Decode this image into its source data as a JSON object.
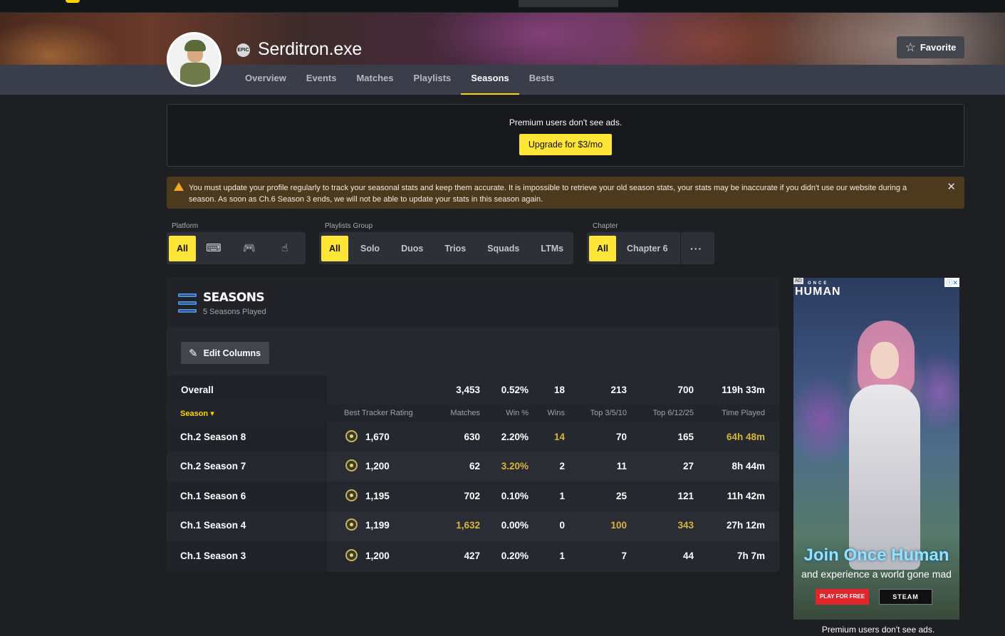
{
  "profile": {
    "username": "Serditron.exe",
    "platform_badge": "EPIC",
    "favorite_label": "Favorite"
  },
  "tabs": [
    "Overview",
    "Events",
    "Matches",
    "Playlists",
    "Seasons",
    "Bests"
  ],
  "active_tab": "Seasons",
  "premium": {
    "text": "Premium users don't see ads.",
    "upgrade_label": "Upgrade for $3/mo"
  },
  "warning": {
    "text": "You must update your profile regularly to track your seasonal stats and keep them accurate. It is impossible to retrieve your old season stats, your stats may be inaccurate if you didn't use our website during a season. As soon as Ch.6 Season 3 ends, we will not be able to update your stats in this season again."
  },
  "filters": {
    "platform": {
      "label": "Platform",
      "all": "All",
      "icons": [
        "keyboard-icon",
        "gamepad-icon",
        "touch-icon"
      ]
    },
    "playlists": {
      "label": "Playlists Group",
      "options": [
        "All",
        "Solo",
        "Duos",
        "Trios",
        "Squads",
        "LTMs"
      ]
    },
    "chapter": {
      "label": "Chapter",
      "options": [
        "All",
        "Chapter 6"
      ],
      "more": "···"
    }
  },
  "seasons_panel": {
    "title": "SEASONS",
    "subtitle": "5 Seasons Played",
    "edit_label": "Edit Columns",
    "overall_label": "Overall",
    "overall": [
      "3,453",
      "0.52%",
      "18",
      "213",
      "700",
      "119h 33m"
    ],
    "sort_label": "Season",
    "headers": [
      "Best Tracker Rating",
      "Matches",
      "Win %",
      "Wins",
      "Top 3/5/10",
      "Top 6/12/25",
      "Time Played"
    ],
    "rows": [
      {
        "season": "Ch.2 Season 8",
        "rating": "1,670",
        "matches": "630",
        "win_pct": "2.20%",
        "wins": "14",
        "top10": "70",
        "top25": "165",
        "time": "64h 48m"
      },
      {
        "season": "Ch.2 Season 7",
        "rating": "1,200",
        "matches": "62",
        "win_pct": "3.20%",
        "wins": "2",
        "top10": "11",
        "top25": "27",
        "time": "8h 44m"
      },
      {
        "season": "Ch.1 Season 6",
        "rating": "1,195",
        "matches": "702",
        "win_pct": "0.10%",
        "wins": "1",
        "top10": "25",
        "top25": "121",
        "time": "11h 42m"
      },
      {
        "season": "Ch.1 Season 4",
        "rating": "1,199",
        "matches": "1,632",
        "win_pct": "0.00%",
        "wins": "0",
        "top10": "100",
        "top25": "343",
        "time": "27h 12m"
      },
      {
        "season": "Ch.1 Season 3",
        "rating": "1,200",
        "matches": "427",
        "win_pct": "0.20%",
        "wins": "1",
        "top10": "7",
        "top25": "44",
        "time": "7h 7m"
      }
    ]
  },
  "ad": {
    "tag": "AD",
    "brand_top": "ONCE",
    "brand": "HUMAN",
    "headline": "Join Once Human",
    "sub": "and experience a world gone mad",
    "cta_primary": "PLAY FOR FREE",
    "cta_secondary": "STEAM",
    "note": "Premium users don't see ads."
  },
  "colors": {
    "accent": "#ffe535",
    "highlight": "#d7b43b",
    "link_blue": "#4b8fe5"
  }
}
